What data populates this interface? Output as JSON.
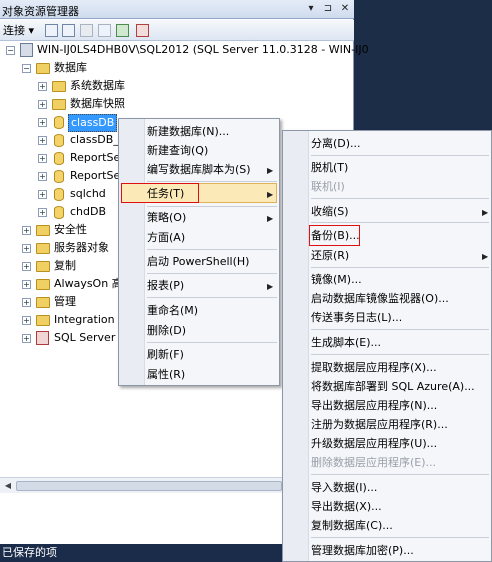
{
  "window": {
    "title": "对象资源管理器"
  },
  "toolbar": {
    "connect_label": "连接 ▾"
  },
  "tree": {
    "server": "WIN-IJ0LS4DHB0V\\SQL2012 (SQL Server 11.0.3128 - WIN-IJ0",
    "databases": "数据库",
    "system_dbs": "系统数据库",
    "snapshots": "数据库快照",
    "classdb": "classDB",
    "classdb2": "classDB_",
    "report1": "ReportSe",
    "report2": "ReportSe",
    "sqlchd": "sqlchd",
    "chddb": "chdDB",
    "security": "安全性",
    "server_objects": "服务器对象",
    "replication": "复制",
    "alwayson": "AlwaysOn 高",
    "management": "管理",
    "integration": "Integration",
    "agent": "SQL Server"
  },
  "context_menu": {
    "new_db": "新建数据库(N)...",
    "new_query": "新建查询(Q)",
    "script_as": "编写数据库脚本为(S)",
    "tasks": "任务(T)",
    "policy": "策略(O)",
    "facets": "方面(A)",
    "powershell": "启动 PowerShell(H)",
    "reports": "报表(P)",
    "rename": "重命名(M)",
    "delete": "删除(D)",
    "refresh": "刷新(F)",
    "properties": "属性(R)"
  },
  "tasks_menu": {
    "detach": "分离(D)...",
    "offline": "脱机(T)",
    "online": "联机(I)",
    "shrink": "收缩(S)",
    "backup": "备份(B)...",
    "restore": "还原(R)",
    "mirror": "镜像(M)...",
    "mirror_monitor": "启动数据库镜像监视器(O)...",
    "log_ship": "传送事务日志(L)...",
    "gen_scripts": "生成脚本(E)...",
    "extract_dac": "提取数据层应用程序(X)...",
    "deploy_azure": "将数据库部署到 SQL Azure(A)...",
    "export_dac": "导出数据层应用程序(N)...",
    "register_dac": "注册为数据层应用程序(R)...",
    "upgrade_dac": "升级数据层应用程序(U)...",
    "delete_dac": "删除数据层应用程序(E)...",
    "import_data": "导入数据(I)...",
    "export_data": "导出数据(X)...",
    "copy_db": "复制数据库(C)...",
    "manage_encryption": "管理数据库加密(P)..."
  },
  "status": {
    "saved": "已保存的项"
  }
}
